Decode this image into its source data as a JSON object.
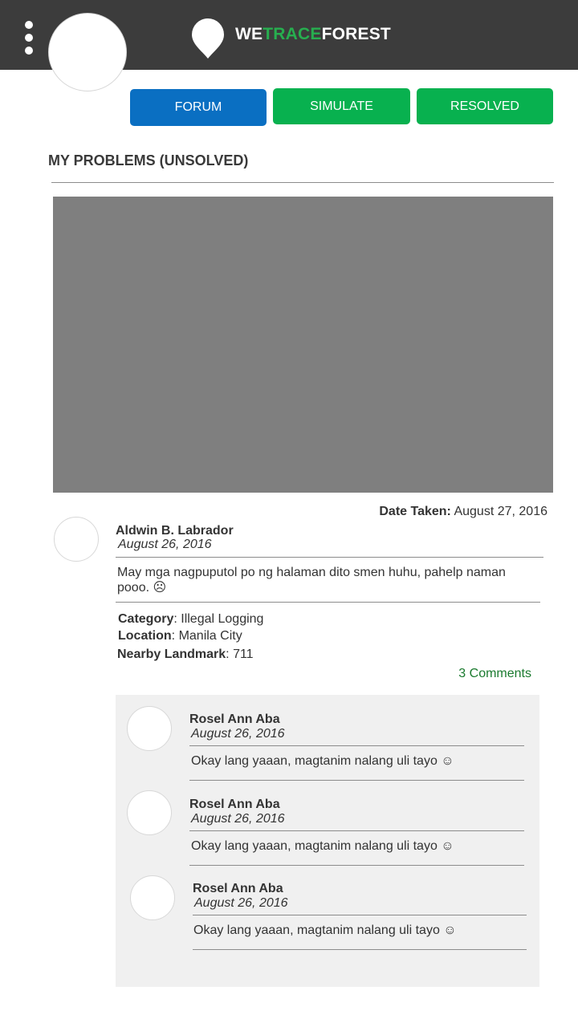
{
  "brand": {
    "part1": "WE",
    "part2": "TRACE",
    "part3": "FOREST"
  },
  "colors": {
    "topbar": "#3c3c3c",
    "forum": "#0a6fc2",
    "green": "#08b14f",
    "brand_green": "#27ae4f",
    "link_green": "#1a7a2e"
  },
  "icons": {
    "menu": "more-vertical-icon",
    "logo": "location-pin-icon"
  },
  "tabs": {
    "forum": "FORUM",
    "simulate": "SIMULATE",
    "resolved": "RESOLVED"
  },
  "section_title": "MY PROBLEMS (UNSOLVED)",
  "post": {
    "date_taken_label": "Date Taken:",
    "date_taken_value": "August 27, 2016",
    "author": "Aldwin B. Labrador",
    "date": "August 26, 2016",
    "text": "May mga nagpuputol po ng halaman dito smen huhu, pahelp naman pooo. ☹",
    "category_label": "Category",
    "category_value": ": Illegal Logging",
    "location_label": "Location",
    "location_value": ": Manila City",
    "landmark_label": "Nearby Landmark",
    "landmark_value": ": 711",
    "comments_count": "3 Comments"
  },
  "comments": [
    {
      "author": "Rosel Ann Aba",
      "date": "August 26, 2016",
      "text": "Okay lang yaaan, magtanim nalang uli tayo ☺"
    },
    {
      "author": "Rosel Ann Aba",
      "date": "August 26, 2016",
      "text": "Okay lang yaaan, magtanim nalang uli tayo ☺"
    },
    {
      "author": "Rosel Ann Aba",
      "date": "August 26, 2016",
      "text": "Okay lang yaaan, magtanim nalang uli tayo ☺"
    }
  ]
}
